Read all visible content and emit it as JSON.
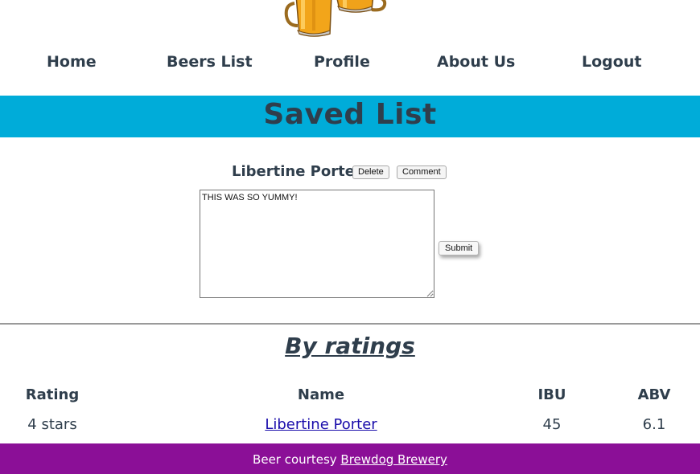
{
  "nav": {
    "home": "Home",
    "beers_list": "Beers List",
    "profile": "Profile",
    "about_us": "About Us",
    "logout": "Logout"
  },
  "banner": {
    "title": "Saved List",
    "color": "#00acd9"
  },
  "saved_item": {
    "name": "Libertine Porter",
    "delete_label": "Delete",
    "comment_label": "Comment",
    "comment_text": "THIS WAS SO YUMMY!",
    "submit_label": "Submit"
  },
  "ratings_section": {
    "title": "By ratings",
    "headers": {
      "rating": "Rating",
      "name": "Name",
      "ibu": "IBU",
      "abv": "ABV"
    },
    "rows": [
      {
        "rating": "4 stars",
        "name": "Libertine Porter",
        "ibu": "45",
        "abv": "6.1"
      }
    ]
  },
  "footer": {
    "prefix": "Beer courtesy",
    "link": "Brewdog Brewery",
    "color": "#8b0f97"
  },
  "icons": {
    "logo": "beer-mugs-icon"
  }
}
